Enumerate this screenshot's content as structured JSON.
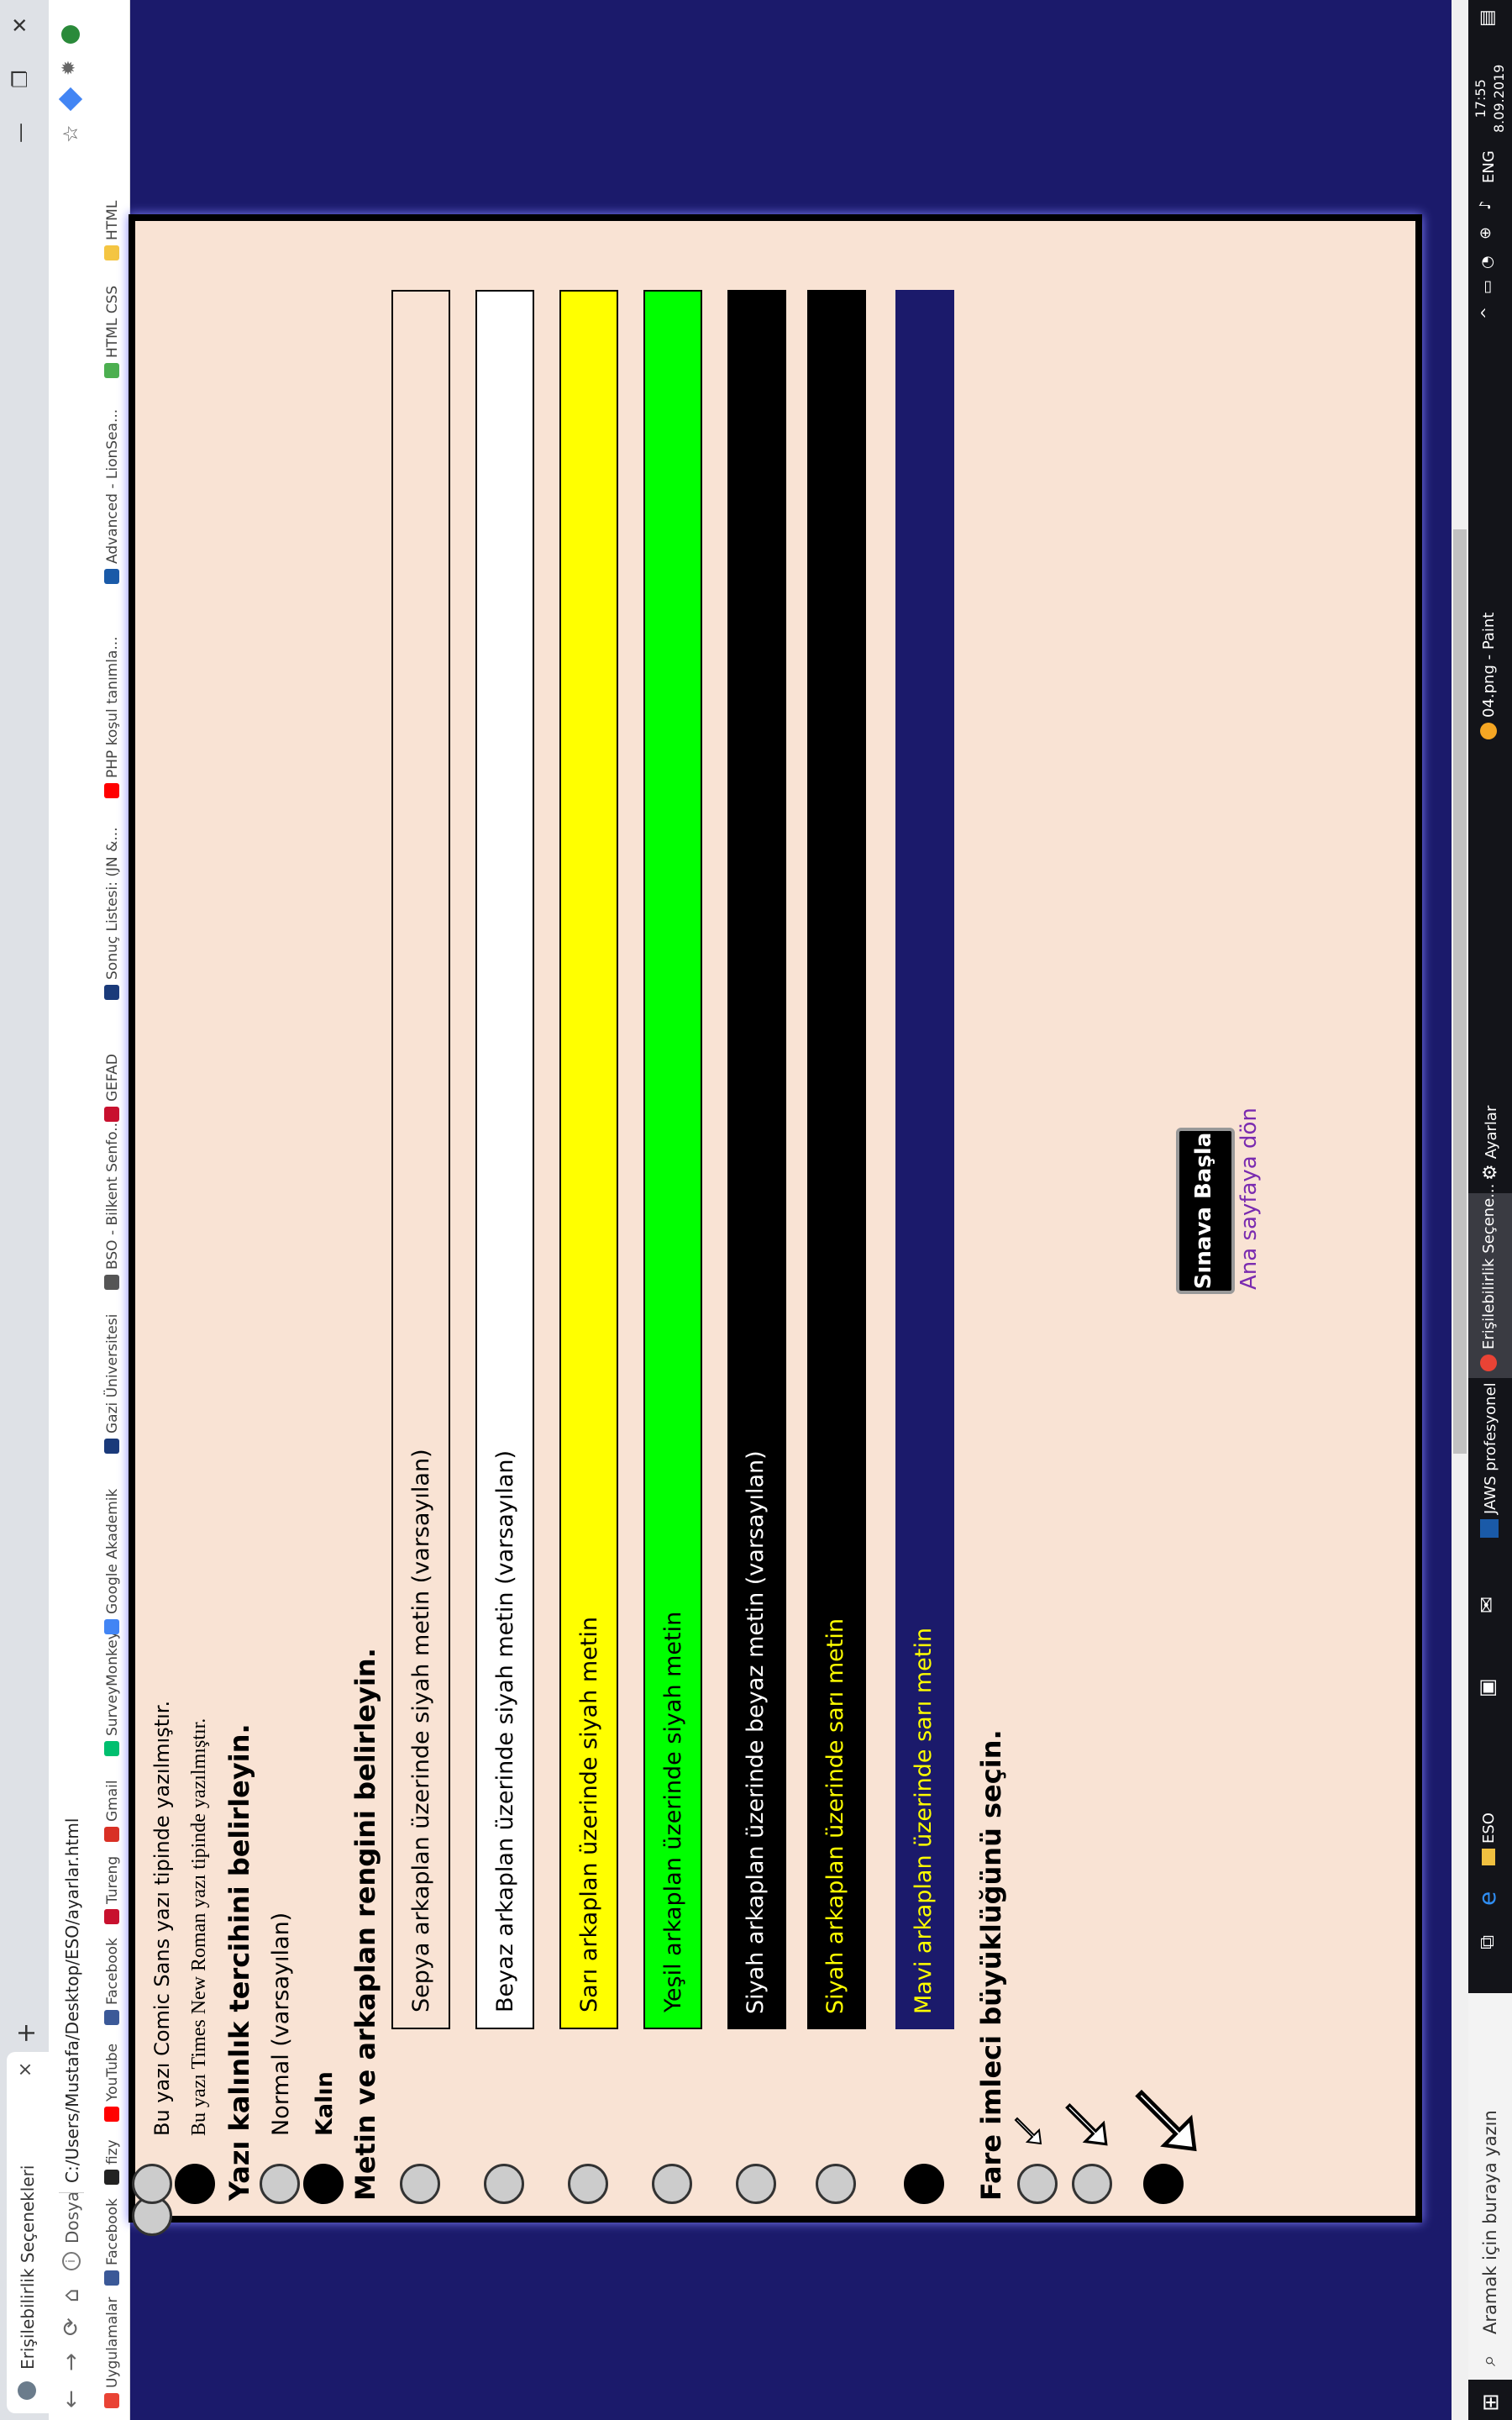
{
  "browser": {
    "tab_title": "Erişilebilirlik Seçenekleri",
    "tab_close": "×",
    "new_tab": "+",
    "window_controls": [
      "—",
      "❐",
      "✕"
    ],
    "address": {
      "protocol": "Dosya",
      "url": "C:/Users/Mustafa/Desktop/ESO/ayarlar.html"
    },
    "bookmarks": [
      {
        "label": "Uygulamalar",
        "color": "#e94335"
      },
      {
        "label": "Facebook",
        "color": "#3b5998"
      },
      {
        "label": "fizy",
        "color": "#222222"
      },
      {
        "label": "YouTube",
        "color": "#ff0000"
      },
      {
        "label": "Facebook",
        "color": "#3b5998"
      },
      {
        "label": "Tureng",
        "color": "#c8102e"
      },
      {
        "label": "Gmail",
        "color": "#d93025"
      },
      {
        "label": "SurveyMonkey",
        "color": "#00bf6f"
      },
      {
        "label": "Google Akademik",
        "color": "#4285f4"
      },
      {
        "label": "Gazi Üniversitesi",
        "color": "#1a3a7a"
      },
      {
        "label": "BSO - Bilkent Senfo...",
        "color": "#555555"
      },
      {
        "label": "GEFAD",
        "color": "#c8102e"
      },
      {
        "label": "Sonuç Listesi: (JN &...",
        "color": "#1a3a7a"
      },
      {
        "label": "PHP koşul tanımla...",
        "color": "#ff0000"
      },
      {
        "label": "Advanced - LionSea...",
        "color": "#1a5aa8"
      },
      {
        "label": "HTML CSS",
        "color": "#4caf50"
      },
      {
        "label": "HTML",
        "color": "#f4c542"
      }
    ]
  },
  "page": {
    "font_options": {
      "comic": "Bu yazı Comic Sans yazı tipinde yazılmıştır.",
      "times": "Bu yazı Times New Roman yazı tipinde yazılmıştır."
    },
    "weight_section": {
      "heading": "Yazı kalınlık tercihini belirleyin.",
      "normal": "Normal (varsayılan)",
      "bold": "Kalın"
    },
    "color_section": {
      "heading": "Metin ve arkaplan rengini belirleyin.",
      "options": [
        {
          "label": "Sepya arkaplan üzerinde siyah metin (varsayılan)",
          "bg": "#f9e3d4",
          "fg": "#000000"
        },
        {
          "label": "Beyaz arkaplan üzerinde siyah metin (varsayılan)",
          "bg": "#ffffff",
          "fg": "#000000"
        },
        {
          "label": "Sarı arkaplan üzerinde siyah metin",
          "bg": "#ffff00",
          "fg": "#000000"
        },
        {
          "label": "Yeşil arkaplan üzerinde siyah metin",
          "bg": "#00ff00",
          "fg": "#000000"
        },
        {
          "label": "Siyah arkaplan üzerinde beyaz metin (varsayılan)",
          "bg": "#000000",
          "fg": "#ffffff"
        },
        {
          "label": "Siyah arkaplan üzerinde sarı metin",
          "bg": "#000000",
          "fg": "#ffff00"
        },
        {
          "label": "Mavi arkaplan üzerinde sarı metin",
          "bg": "#1b1a6b",
          "fg": "#ffff00"
        }
      ]
    },
    "cursor_section": {
      "heading": "Fare imleci büyüklüğünü seçin."
    },
    "start_button": "Sınava Başla",
    "home_link": "Ana sayfaya dön"
  },
  "taskbar": {
    "search_placeholder": "Aramak için buraya yazın",
    "items": [
      "ESO",
      "JAWS profesyonel",
      "Erişilebilirlik Seçene...",
      "Ayarlar",
      "04.png - Paint"
    ],
    "language": "ENG",
    "time": "17:55",
    "date": "8.09.2019"
  }
}
